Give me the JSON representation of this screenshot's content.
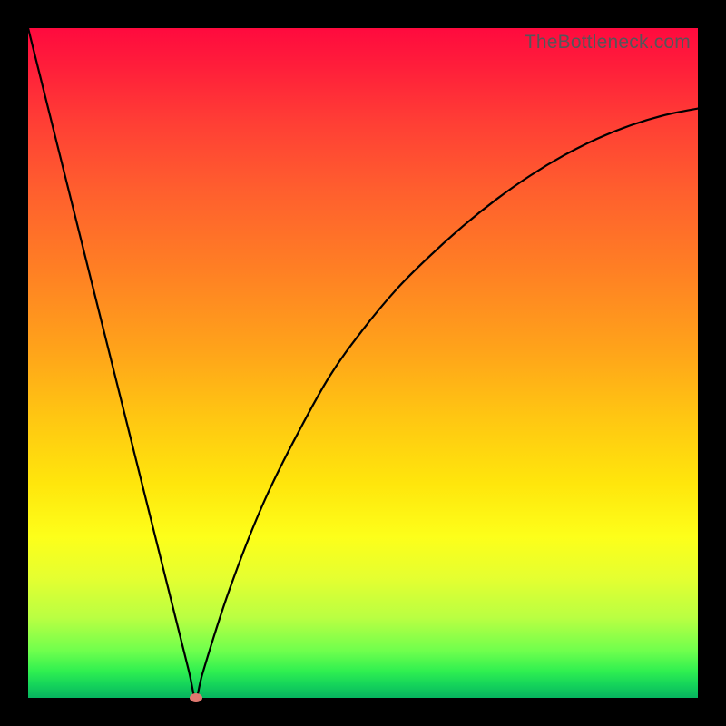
{
  "watermark": "TheBottleneck.com",
  "colors": {
    "frame": "#000000",
    "curve": "#000000",
    "marker": "#e07870"
  },
  "chart_data": {
    "type": "line",
    "title": "",
    "xlabel": "",
    "ylabel": "",
    "xlim": [
      0,
      100
    ],
    "ylim": [
      0,
      100
    ],
    "grid": false,
    "legend": false,
    "series": [
      {
        "name": "bottleneck-curve",
        "x": [
          0,
          5,
          10,
          15,
          20,
          22,
          24,
          25,
          26,
          28,
          30,
          33,
          36,
          40,
          45,
          50,
          55,
          60,
          65,
          70,
          75,
          80,
          85,
          90,
          95,
          100
        ],
        "y": [
          100,
          80,
          60,
          40,
          20,
          12,
          4,
          0,
          3.5,
          10,
          16,
          24,
          31,
          39,
          48,
          55,
          61,
          66,
          70.5,
          74.5,
          78,
          81,
          83.5,
          85.5,
          87,
          88
        ]
      }
    ],
    "marker": {
      "x": 25,
      "y": 0
    },
    "background_gradient": {
      "type": "linear-vertical",
      "stops": [
        {
          "pos": 0,
          "color": "#ff0a3e"
        },
        {
          "pos": 24,
          "color": "#ff5e2e"
        },
        {
          "pos": 48,
          "color": "#ffa31a"
        },
        {
          "pos": 68,
          "color": "#ffe60c"
        },
        {
          "pos": 88,
          "color": "#baff42"
        },
        {
          "pos": 100,
          "color": "#07b55f"
        }
      ]
    }
  }
}
